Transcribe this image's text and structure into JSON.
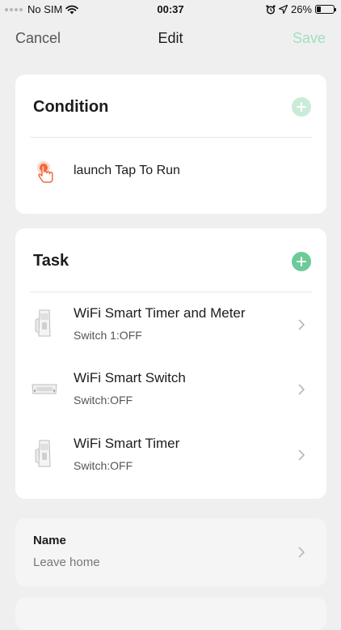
{
  "status_bar": {
    "carrier": "No SIM",
    "time": "00:37",
    "battery_percent": "26%",
    "battery_level": 0.26,
    "icons": [
      "signal-dots-icon",
      "wifi-icon",
      "alarm-icon",
      "location-arrow-icon",
      "battery-icon"
    ]
  },
  "nav": {
    "cancel": "Cancel",
    "title": "Edit",
    "save": "Save"
  },
  "condition": {
    "title": "Condition",
    "item": {
      "icon": "tap-hand-icon",
      "label": "launch Tap To Run"
    }
  },
  "task": {
    "title": "Task",
    "items": [
      {
        "icon": "smart-timer-meter-device-icon",
        "title": "WiFi Smart Timer and Meter",
        "subtitle": "Switch 1:OFF"
      },
      {
        "icon": "smart-switch-device-icon",
        "title": "WiFi Smart Switch",
        "subtitle": "Switch:OFF"
      },
      {
        "icon": "smart-timer-device-icon",
        "title": "WiFi Smart Timer",
        "subtitle": "Switch:OFF"
      }
    ]
  },
  "name_section": {
    "label": "Name",
    "value": "Leave home"
  },
  "colors": {
    "accent_green": "#6ccb99",
    "save_disabled": "#a3dfbd",
    "tap_icon_orange": "#f06a3c",
    "background": "#efefef"
  }
}
